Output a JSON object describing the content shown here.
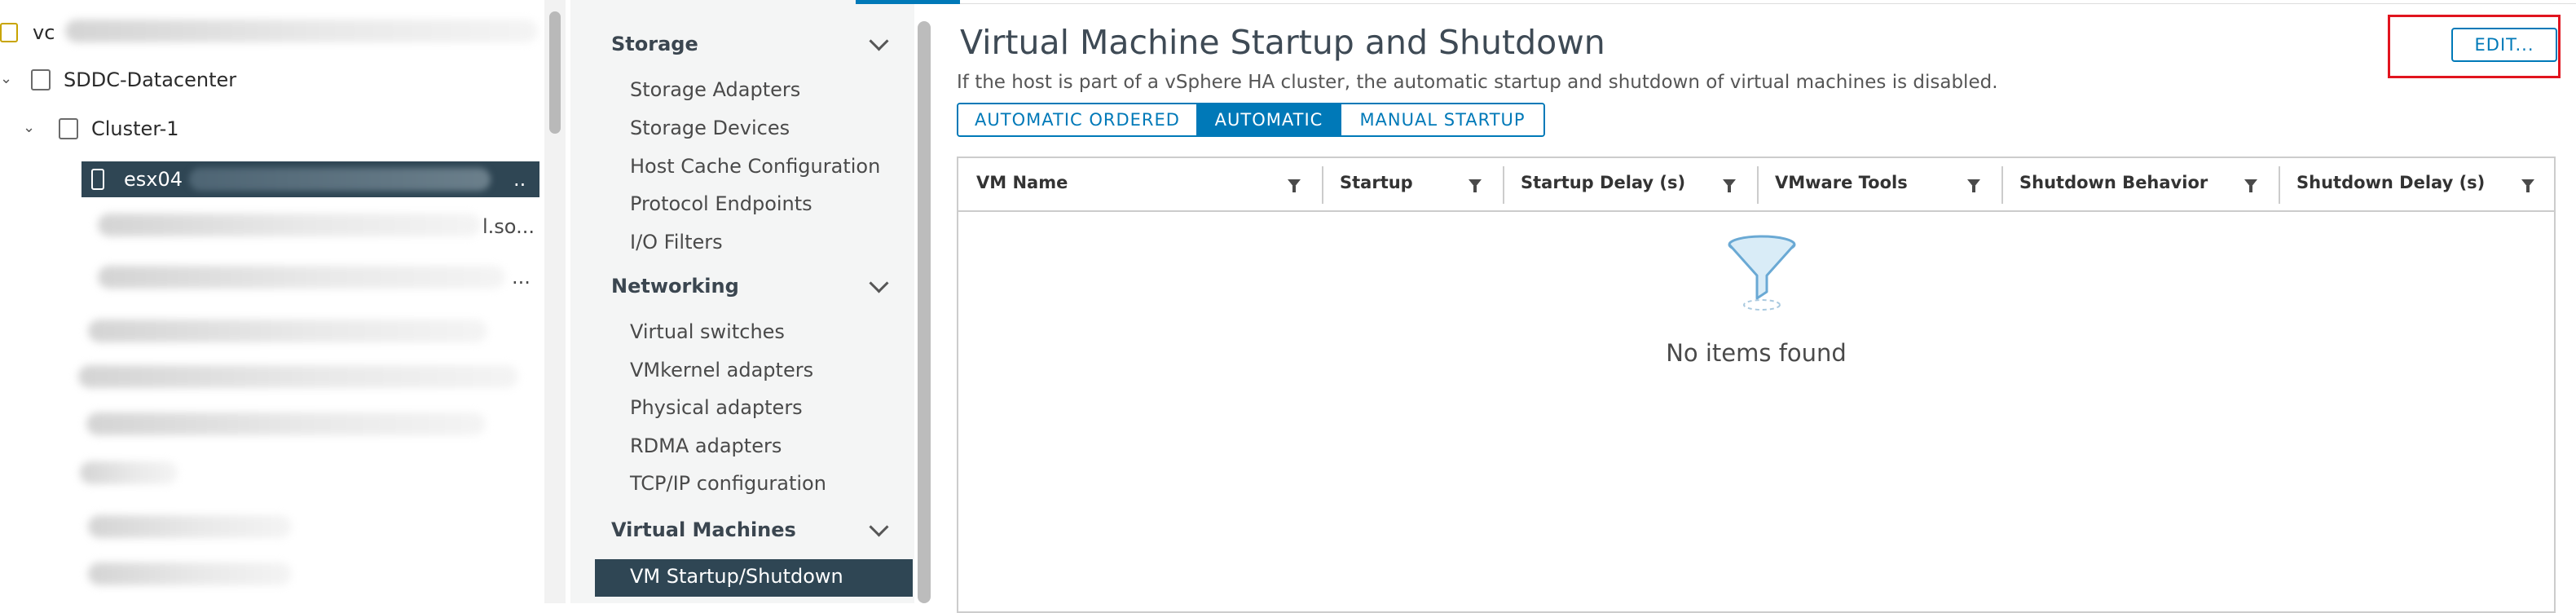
{
  "tree": {
    "root_label": "vc",
    "datacenter_label": "SDDC-Datacenter",
    "cluster_label": "Cluster-1",
    "host_label": "esx04",
    "row_suffixes": [
      "..",
      "l.so...",
      "..."
    ]
  },
  "nav": {
    "sections": [
      {
        "label": "Storage",
        "items": [
          "Storage Adapters",
          "Storage Devices",
          "Host Cache Configuration",
          "Protocol Endpoints",
          "I/O Filters"
        ]
      },
      {
        "label": "Networking",
        "items": [
          "Virtual switches",
          "VMkernel adapters",
          "Physical adapters",
          "RDMA adapters",
          "TCP/IP configuration"
        ]
      },
      {
        "label": "Virtual Machines",
        "items": [
          "VM Startup/Shutdown"
        ]
      }
    ]
  },
  "main": {
    "title": "Virtual Machine Startup and Shutdown",
    "description": "If the host is part of a vSphere HA cluster, the automatic startup and shutdown of virtual machines is disabled.",
    "edit_label": "EDIT...",
    "modes": [
      "AUTOMATIC ORDERED",
      "AUTOMATIC",
      "MANUAL STARTUP"
    ],
    "active_mode": "AUTOMATIC",
    "columns": [
      "VM Name",
      "Startup",
      "Startup Delay (s)",
      "VMware Tools",
      "Shutdown Behavior",
      "Shutdown Delay (s)"
    ],
    "empty_text": "No items found"
  },
  "colors": {
    "accent": "#0079b8",
    "selected_row": "#2f4654",
    "highlight": "#e1141e"
  }
}
